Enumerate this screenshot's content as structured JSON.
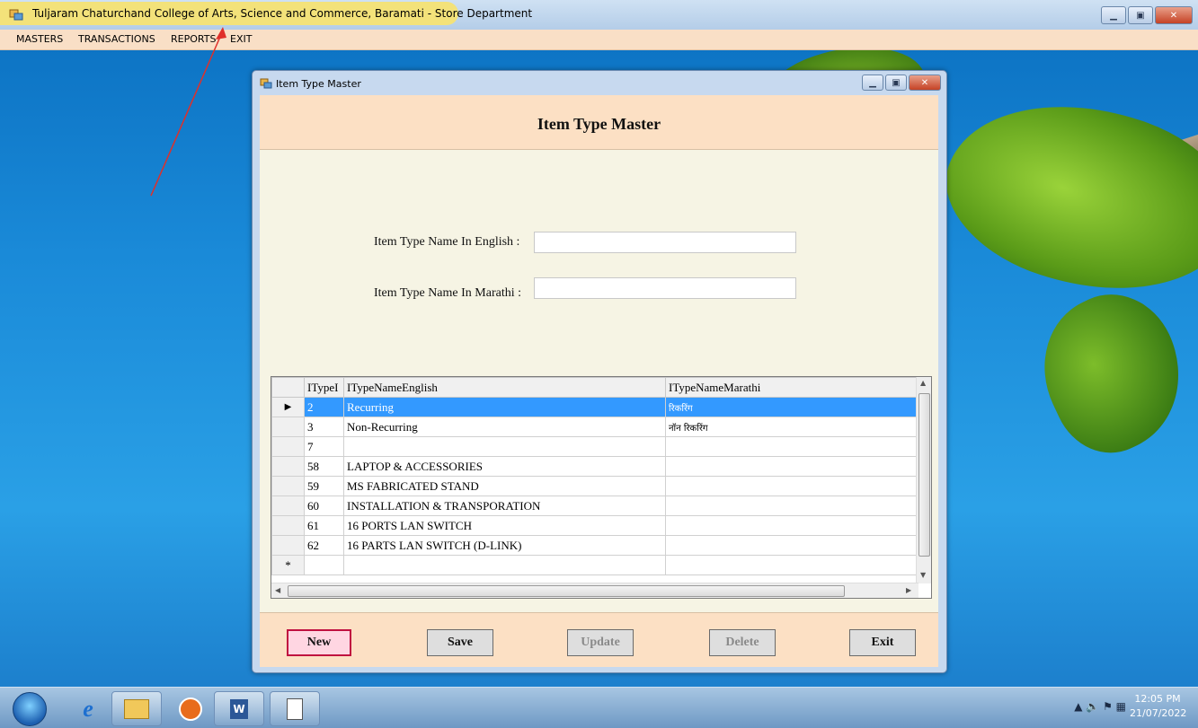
{
  "app": {
    "title": "Tuljaram Chaturchand College of Arts, Science and Commerce, Baramati - Store Department",
    "menu": [
      "MASTERS",
      "TRANSACTIONS",
      "REPORTS",
      "EXIT"
    ]
  },
  "child_window": {
    "title": "Item Type Master",
    "form_title": "Item Type Master",
    "fields": {
      "english_label": "Item Type Name In English :",
      "english_value": "",
      "marathi_label": "Item Type Name In Marathi :",
      "marathi_value": ""
    },
    "grid": {
      "columns": [
        "ITypeI",
        "ITypeNameEnglish",
        "ITypeNameMarathi"
      ],
      "rows": [
        {
          "id": "2",
          "english": "Recurring",
          "marathi": "रिकरिंग",
          "selected": true
        },
        {
          "id": "3",
          "english": "Non-Recurring",
          "marathi": "नॉन रिकरिंग"
        },
        {
          "id": "7",
          "english": "",
          "marathi": ""
        },
        {
          "id": "58",
          "english": "LAPTOP & ACCESSORIES",
          "marathi": ""
        },
        {
          "id": "59",
          "english": "MS FABRICATED STAND",
          "marathi": ""
        },
        {
          "id": "60",
          "english": "INSTALLATION & TRANSPORATION",
          "marathi": ""
        },
        {
          "id": "61",
          "english": "16 PORTS LAN SWITCH",
          "marathi": ""
        },
        {
          "id": "62",
          "english": "16 PARTS LAN SWITCH (D-LINK)",
          "marathi": ""
        }
      ],
      "new_row_marker": "*",
      "current_row_marker": "▶"
    },
    "buttons": {
      "new": "New",
      "save": "Save",
      "update": "Update",
      "delete": "Delete",
      "exit": "Exit"
    }
  },
  "taskbar": {
    "time": "12:05 PM",
    "date": "21/07/2022"
  },
  "colors": {
    "selected_row": "#3399ff",
    "panel": "#fce0c4",
    "form_bg": "#f6f4e4",
    "title_highlight": "#f3e27a",
    "active_button_border": "#c01040"
  }
}
